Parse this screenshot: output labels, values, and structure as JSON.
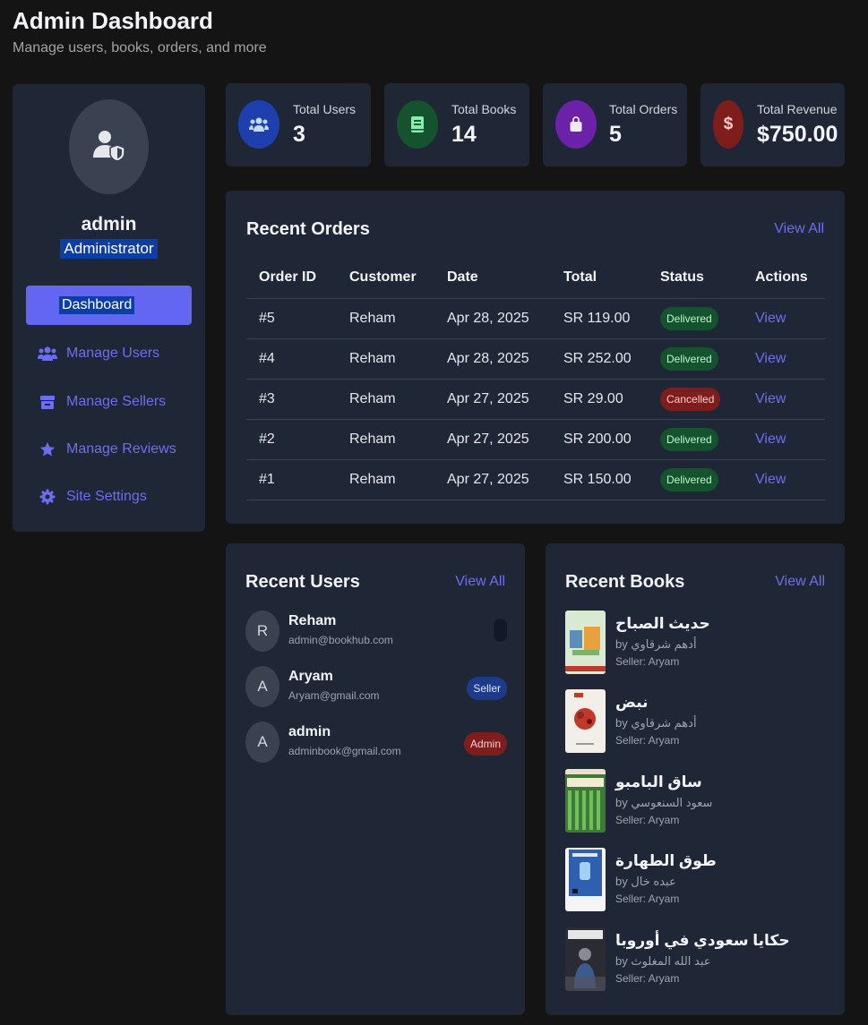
{
  "header": {
    "title": "Admin Dashboard",
    "subtitle": "Manage users, books, orders, and more"
  },
  "sidebar": {
    "profile": {
      "name": "admin",
      "role": "Administrator",
      "avatar_icon": "user-shield-icon"
    },
    "active_item": "Dashboard",
    "items": [
      {
        "label": "Manage Users",
        "icon": "users-icon"
      },
      {
        "label": "Manage Sellers",
        "icon": "store-icon"
      },
      {
        "label": "Manage Reviews",
        "icon": "star-icon"
      },
      {
        "label": "Site Settings",
        "icon": "gear-icon"
      }
    ]
  },
  "stats": [
    {
      "label": "Total Users",
      "value": "3",
      "icon": "users-icon",
      "color": "#1e40af"
    },
    {
      "label": "Total Books",
      "value": "14",
      "icon": "book-icon",
      "color": "#14532d"
    },
    {
      "label": "Total Orders",
      "value": "5",
      "icon": "shopping-bag-icon",
      "color": "#6b21a8"
    },
    {
      "label": "Total Revenue",
      "value": "$750.00",
      "icon": "dollar-icon",
      "color": "#7f1d1d"
    }
  ],
  "recent_orders": {
    "title": "Recent Orders",
    "view_all": "View All",
    "columns": [
      "Order ID",
      "Customer",
      "Date",
      "Total",
      "Status",
      "Actions"
    ],
    "rows": [
      {
        "id": "#5",
        "customer": "Reham",
        "date": "Apr 28, 2025",
        "total": "SR 119.00",
        "status": "Delivered",
        "action": "View"
      },
      {
        "id": "#4",
        "customer": "Reham",
        "date": "Apr 28, 2025",
        "total": "SR 252.00",
        "status": "Delivered",
        "action": "View"
      },
      {
        "id": "#3",
        "customer": "Reham",
        "date": "Apr 27, 2025",
        "total": "SR 29.00",
        "status": "Cancelled",
        "action": "View"
      },
      {
        "id": "#2",
        "customer": "Reham",
        "date": "Apr 27, 2025",
        "total": "SR 200.00",
        "status": "Delivered",
        "action": "View"
      },
      {
        "id": "#1",
        "customer": "Reham",
        "date": "Apr 27, 2025",
        "total": "SR 150.00",
        "status": "Delivered",
        "action": "View"
      }
    ]
  },
  "recent_users": {
    "title": "Recent Users",
    "view_all": "View All",
    "users": [
      {
        "initial": "R",
        "name": "Reham",
        "email": "admin@bookhub.com",
        "role": ""
      },
      {
        "initial": "A",
        "name": "Aryam",
        "email": "Aryam@gmail.com",
        "role": "Seller"
      },
      {
        "initial": "A",
        "name": "admin",
        "email": "adminbook@gmail.com",
        "role": "Admin"
      }
    ]
  },
  "recent_books": {
    "title": "Recent Books",
    "view_all": "View All",
    "books": [
      {
        "title": "حديث الصباح",
        "author": "by أدهم شرقاوي",
        "seller": "Seller: Aryam",
        "cover_color": "#d9ead3"
      },
      {
        "title": "نبض",
        "author": "by أدهم شرقاوي",
        "seller": "Seller: Aryam",
        "cover_color": "#f2efe9"
      },
      {
        "title": "ساق البامبو",
        "author": "by سعود السنعوسي",
        "seller": "Seller: Aryam",
        "cover_color": "#3f7a34"
      },
      {
        "title": "طوق الطهارة",
        "author": "by عبده خال",
        "seller": "Seller: Aryam",
        "cover_color": "#2f5fb0"
      },
      {
        "title": "حكايا سعودي في أوروبا",
        "author": "by عبد الله المغلوث",
        "seller": "Seller: Aryam",
        "cover_color": "#2b2b33"
      }
    ]
  }
}
